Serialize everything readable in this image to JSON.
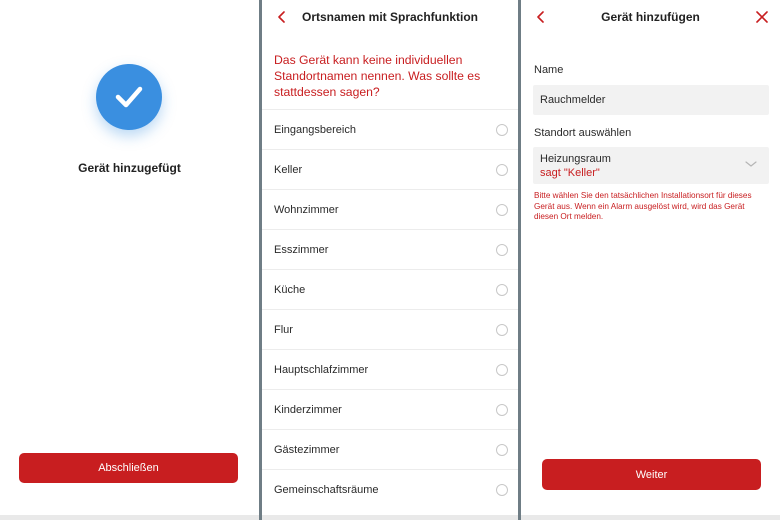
{
  "screen1": {
    "success_text": "Gerät hinzugefügt",
    "finish_button": "Abschließen",
    "icon": "checkmark-icon"
  },
  "screen2": {
    "title": "Ortsnamen mit Sprachfunktion",
    "question": "Das Gerät kann keine individuellen Standortnamen nennen. Was sollte es stattdessen sagen?",
    "options": [
      "Eingangsbereich",
      "Keller",
      "Wohnzimmer",
      "Esszimmer",
      "Küche",
      "Flur",
      "Hauptschlafzimmer",
      "Kinderzimmer",
      "Gästezimmer",
      "Gemeinschaftsräume"
    ]
  },
  "screen3": {
    "title": "Gerät hinzufügen",
    "name_label": "Name",
    "name_value": "Rauchmelder",
    "location_label": "Standort auswählen",
    "location_value": "Heizungsraum",
    "location_says": "sagt \"Keller\"",
    "hint": "Bitte wählen Sie den tatsächlichen Installationsort für dieses Gerät aus. Wenn ein Alarm ausgelöst wird, wird das Gerät diesen Ort melden.",
    "next_button": "Weiter"
  },
  "colors": {
    "accent_red": "#c81e20",
    "success_blue": "#3a8fe0",
    "divider": "#6f7d85"
  }
}
